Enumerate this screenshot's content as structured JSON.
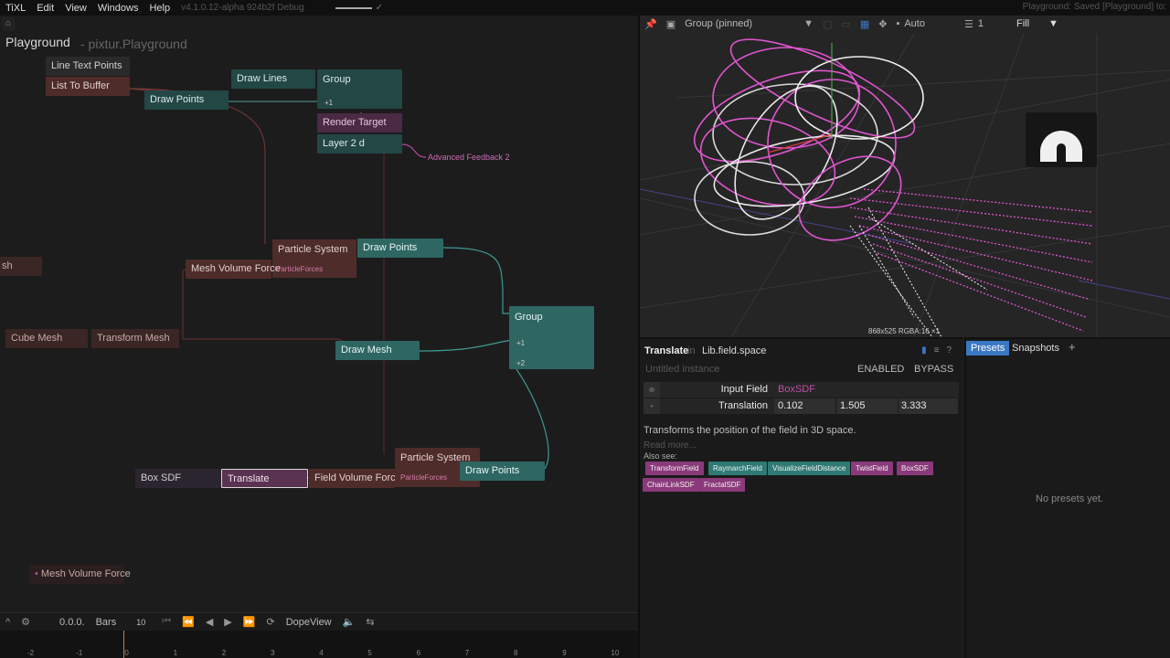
{
  "menubar": {
    "app": "TiXL",
    "items": [
      "Edit",
      "View",
      "Windows",
      "Help"
    ],
    "version": "v4.1.0.12-alpha 924b2f Debug",
    "status": "Playground: Saved [Playground] to:"
  },
  "graph": {
    "title": "Playground",
    "subtitle": "- pixtur.Playground",
    "nodes": {
      "line_text_points": "Line Text Points",
      "list_to_buffer": "List To Buffer",
      "draw_points_1": "Draw Points",
      "draw_lines": "Draw Lines",
      "group_1": "Group",
      "group_1_input": "+1",
      "render_target": "Render Target",
      "layer_2d": "Layer 2 d",
      "advanced_feedback": "Advanced Feedback 2",
      "mesh_partial": "sh",
      "particle_system_1": "Particle System",
      "draw_points_2": "Draw Points",
      "mesh_volume_force": "Mesh Volume Force",
      "particle_forces_1": "ParticleForces",
      "cube_mesh": "Cube Mesh",
      "transform_mesh": "Transform Mesh",
      "draw_mesh": "Draw Mesh",
      "group_2": "Group",
      "group_2_input1": "+1",
      "group_2_input2": "+2",
      "box_sdf": "Box SDF",
      "translate": "Translate",
      "field_volume_force": "Field Volume Force",
      "particle_system_2": "Particle System",
      "particle_forces_2": "ParticleForces",
      "draw_points_3": "Draw Points",
      "mesh_volume_force_2": "Mesh Volume Force"
    }
  },
  "timeline": {
    "time": "0.0.0.",
    "mode": "Bars",
    "value": "10",
    "view": "DopeView",
    "ticks": [
      "-2",
      "-1",
      "0",
      "1",
      "2",
      "3",
      "4",
      "5",
      "6",
      "7",
      "8",
      "9",
      "10"
    ]
  },
  "viewport": {
    "pinned": "Group (pinned)",
    "camera_mode": "Auto",
    "layer": "1",
    "fill": "Fill",
    "info": "868x525  RGBA:16  ×1"
  },
  "inspector": {
    "operator": "Translate",
    "in": "in",
    "namespace": "Lib.field.space",
    "instance": "Untitled instance",
    "enabled": "ENABLED",
    "bypass": "BYPASS",
    "params": [
      {
        "label": "Input Field",
        "value": "BoxSDF"
      },
      {
        "label": "Translation",
        "x": "0.102",
        "y": "1.505",
        "z": "3.333"
      }
    ],
    "description": "Transforms the position of the field in 3D space.",
    "read_more": "Read more...",
    "also_see": "Also see:",
    "tags": [
      "TransformField",
      "RaymarchField",
      "VisualizeFieldDistance",
      "TwistField",
      "BoxSDF",
      "ChainLinkSDF",
      "FractalSDF"
    ]
  },
  "presets": {
    "tab_presets": "Presets",
    "tab_snapshots": "Snapshots",
    "add": "+",
    "empty": "No presets yet."
  },
  "colors": {
    "accent_blue": "#3b78c4",
    "node_red": "#4e2c2a",
    "node_teal": "#2e6662",
    "link_pink": "#c04ea4",
    "particle_pink": "#e055d0",
    "playhead": "#e07a2a"
  }
}
